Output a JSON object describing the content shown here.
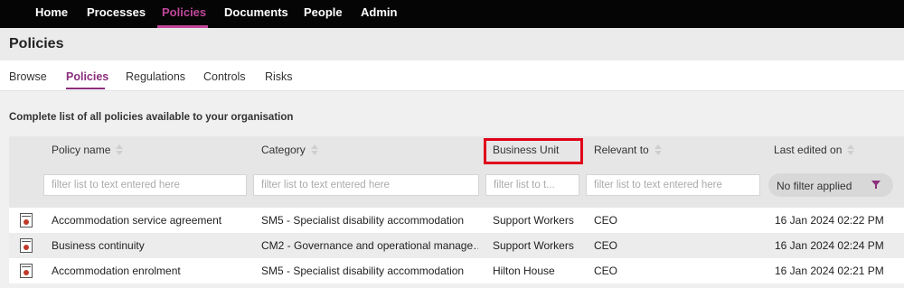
{
  "topnav": {
    "items": [
      "Home",
      "Processes",
      "Policies",
      "Documents",
      "People",
      "Admin"
    ],
    "active": "Policies"
  },
  "page_title": "Policies",
  "subnav": {
    "tabs": [
      "Browse",
      "Policies",
      "Regulations",
      "Controls",
      "Risks"
    ],
    "active": "Policies"
  },
  "description": "Complete list of all policies available to your organisation",
  "table": {
    "columns": [
      "Policy name",
      "Category",
      "Business Unit",
      "Relevant to",
      "Last edited on"
    ],
    "sorted_column": "Business Unit",
    "sort_direction": "descending",
    "filter_placeholders": {
      "policy_name": "filter list to text entered here",
      "category": "filter list to text entered here",
      "business_unit": "filter list to t...",
      "relevant_to": "filter list to text entered here"
    },
    "date_filter_label": "No filter applied",
    "rows": [
      [
        "Accommodation service agreement",
        "SM5 - Specialist disability accommodation",
        "Support Workers",
        "CEO",
        "16 Jan 2024 02:22 PM"
      ],
      [
        "Business continuity",
        "CM2 - Governance and operational manage…",
        "Support Workers",
        "CEO",
        "16 Jan 2024 02:24 PM"
      ],
      [
        "Accommodation enrolment",
        "SM5 - Specialist disability accommodation",
        "Hilton House",
        "CEO",
        "16 Jan 2024 02:21 PM"
      ]
    ]
  },
  "colors": {
    "accent": "#8b2f7c",
    "topnav_active": "#c0469a",
    "highlight_box": "#e0001a"
  },
  "icons": {
    "row_icon": "policy-document-icon",
    "sort_icon": "sort-arrows-icon",
    "filter_icon": "funnel-icon"
  }
}
